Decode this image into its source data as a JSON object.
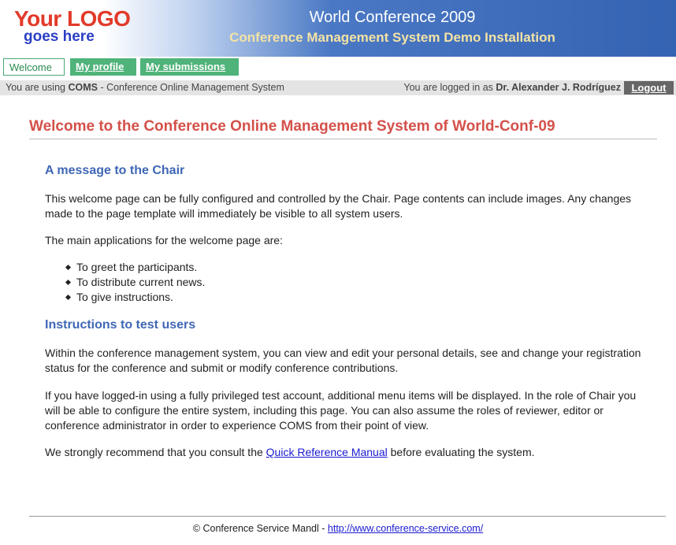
{
  "logo": {
    "line1": "Your LOGO",
    "line2": "goes here"
  },
  "header": {
    "title": "World Conference 2009",
    "subtitle": "Conference Management System Demo Installation"
  },
  "tabs": [
    {
      "label": "Welcome",
      "active": true
    },
    {
      "label": "My profile",
      "active": false
    },
    {
      "label": "My submissions",
      "active": false
    }
  ],
  "status": {
    "left_prefix": "You are using ",
    "left_app": "COMS",
    "left_suffix": " - Conference Online Management System",
    "right_prefix": "You are logged in as ",
    "user": "Dr. Alexander J. Rodríguez",
    "logout": "Logout"
  },
  "main": {
    "title": "Welcome to the Conference Online Management System of World-Conf-09",
    "section1": {
      "heading": "A message to the Chair",
      "p1": "This welcome page can be fully configured and controlled by the Chair. Page contents can include images. Any changes made to the page template will immediately be visible to all system users.",
      "p2": "The main applications for the welcome page are:",
      "items": [
        "To greet the participants.",
        "To distribute current news.",
        "To give instructions."
      ]
    },
    "section2": {
      "heading": "Instructions to test users",
      "p1": "Within the conference management system, you can view and edit your personal details, see and change your registration status for the conference and submit or modify conference contributions.",
      "p2": "If you have logged-in using a fully privileged test account, additional menu items will be displayed. In the role of Chair you will be able to configure the entire system, including this page. You can also assume the roles of reviewer, editor or conference administrator in order to experience COMS from their point of view.",
      "p3_prefix": "We strongly recommend that you consult the ",
      "p3_link": "Quick Reference Manual",
      "p3_suffix": " before evaluating the system."
    }
  },
  "footer": {
    "text": "© Conference Service Mandl - ",
    "link": "http://www.conference-service.com/"
  },
  "colors": {
    "title_red": "#d4504a",
    "heading_blue": "#3f67b5",
    "tab_green": "#4fb37a",
    "header_blue": "#3563b3"
  }
}
